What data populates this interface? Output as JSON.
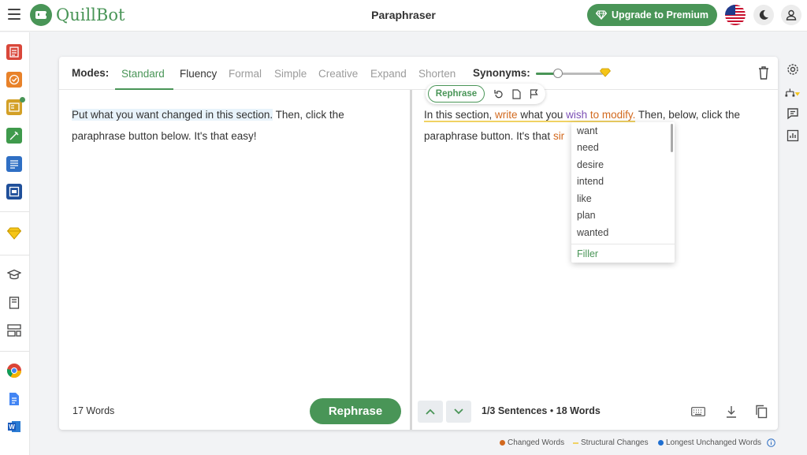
{
  "app": {
    "logo_text": "QuillBot",
    "title": "Paraphraser",
    "premium_label": "Upgrade to Premium"
  },
  "modes": {
    "label": "Modes:",
    "items": [
      {
        "label": "Standard",
        "state": "active"
      },
      {
        "label": "Fluency",
        "state": "enabled"
      },
      {
        "label": "Formal",
        "state": "premium"
      },
      {
        "label": "Simple",
        "state": "premium"
      },
      {
        "label": "Creative",
        "state": "premium"
      },
      {
        "label": "Expand",
        "state": "premium"
      },
      {
        "label": "Shorten",
        "state": "premium"
      }
    ],
    "synonyms_label": "Synonyms:",
    "synonyms_level": 0.33
  },
  "input": {
    "highlighted": "Put what you want changed in this section.",
    "rest": " Then, click the paraphrase button below. It's that easy!",
    "word_count": "17 Words",
    "rephrase_label": "Rephrase"
  },
  "output": {
    "seg1": "In this section, ",
    "seg2": "write",
    "seg3": " what you ",
    "seg4": "wish",
    "seg5": " ",
    "seg6": "to modify.",
    "seg7": " Then, below, click the paraphrase button. It's that ",
    "seg8": "sir",
    "toolbar_rephrase": "Rephrase",
    "sentence_info": "1/3 Sentences",
    "bullet": "•",
    "word_count": "18 Words"
  },
  "synonym_dropdown": {
    "items": [
      "want",
      "need",
      "desire",
      "intend",
      "like",
      "plan",
      "wanted"
    ],
    "filler": "Filler"
  },
  "legend": {
    "changed": "Changed Words",
    "structural": "Structural Changes",
    "unchanged": "Longest Unchanged Words"
  },
  "colors": {
    "brand": "#499557",
    "changed": "#d2691e",
    "structural": "#f0d264",
    "unchanged": "#1f6fd1",
    "premium_gem": "#e8b400"
  }
}
